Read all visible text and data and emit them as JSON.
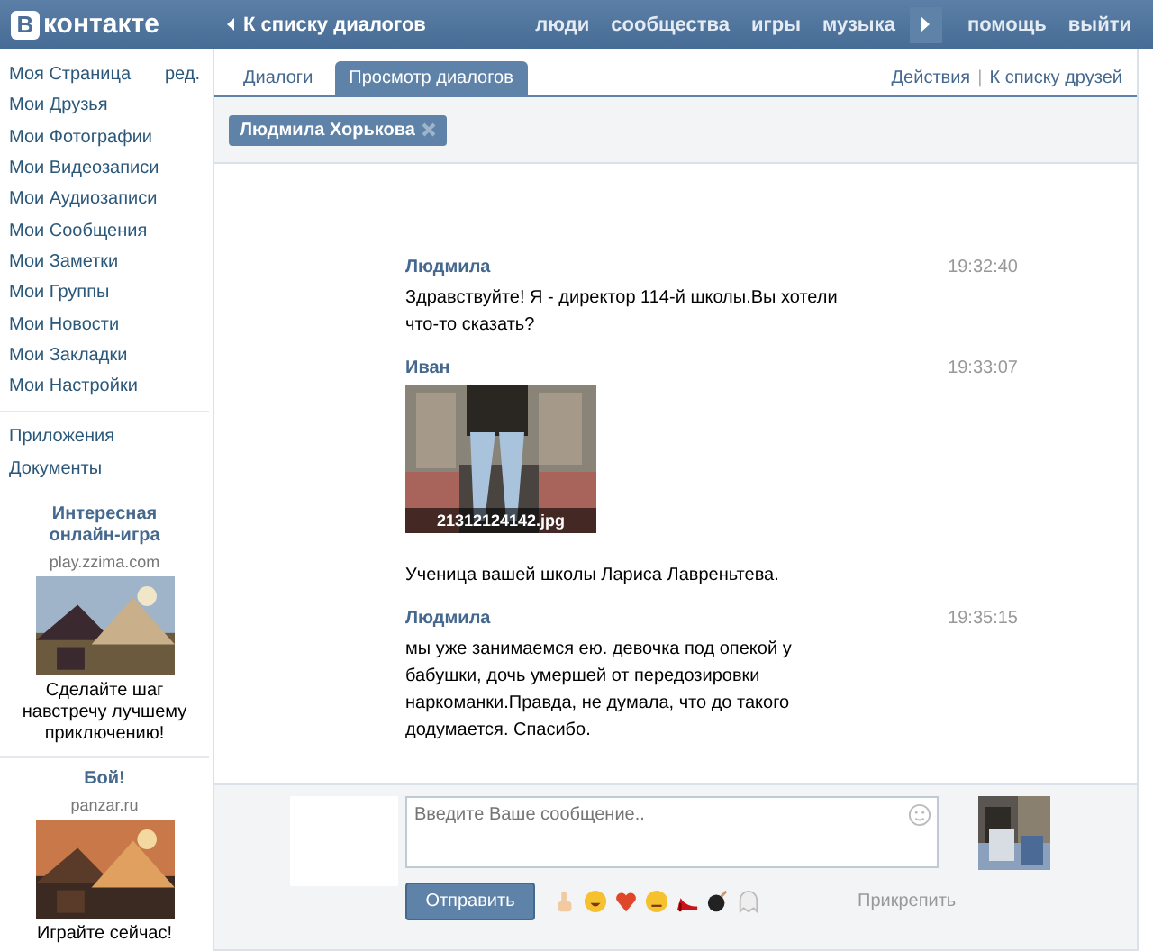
{
  "header": {
    "logo": {
      "mark": "В",
      "name": "контакте"
    },
    "back_link": "К списку диалогов",
    "nav": [
      "люди",
      "сообщества",
      "игры",
      "музыка"
    ],
    "nav_right": [
      "помощь",
      "выйти"
    ]
  },
  "sidebar": {
    "groups": [
      {
        "items": [
          {
            "label": "Моя Страница",
            "extra": "ред."
          },
          {
            "label": "Мои Друзья"
          },
          {
            "label": "Мои Фотографии"
          },
          {
            "label": "Мои Видеозаписи"
          },
          {
            "label": "Мои Аудиозаписи"
          },
          {
            "label": "Мои Сообщения"
          },
          {
            "label": "Мои Заметки"
          },
          {
            "label": "Мои Группы"
          },
          {
            "label": "Мои Новости"
          },
          {
            "label": "Мои Закладки"
          },
          {
            "label": "Мои Настройки"
          }
        ]
      },
      {
        "items": [
          {
            "label": "Приложения"
          },
          {
            "label": "Документы"
          }
        ]
      }
    ]
  },
  "ads": [
    {
      "title": "Интересная онлайн-игра",
      "domain": "play.zzima.com",
      "text": "Сделайте шаг навстречу лучшему приключению!"
    },
    {
      "title": "Бой!",
      "domain": "panzar.ru",
      "text": "Играйте сейчас!"
    }
  ],
  "tabs": [
    {
      "label": "Диалоги",
      "selected": false
    },
    {
      "label": "Просмотр диалогов",
      "selected": true
    }
  ],
  "actions": [
    "Действия",
    "К списку друзей"
  ],
  "actions_separator": "|",
  "recipient": "Людмила Хорькова",
  "messages": [
    {
      "author": "Людмила",
      "time": "19:32:40",
      "text": "Здравствуйте! Я - директор 114-й школы.Вы хотели что-то сказать?"
    },
    {
      "author": "Иван",
      "time": "19:33:07",
      "attachment": {
        "kind": "picture",
        "filename": "21312124142.jpg"
      },
      "text": "Ученица вашей школы Лариса Лавреньтева."
    },
    {
      "author": "Людмила",
      "time": "19:35:15",
      "text": "мы уже занимаемся ею. девочка под опекой у бабушки, дочь умершей от передозировки наркоманки.Правда, не думала, что до такого додумается. Спасибо."
    }
  ],
  "compose": {
    "placeholder": "Введите Ваше сообщение..",
    "send": "Отправить",
    "attach": "Прикрепить"
  }
}
